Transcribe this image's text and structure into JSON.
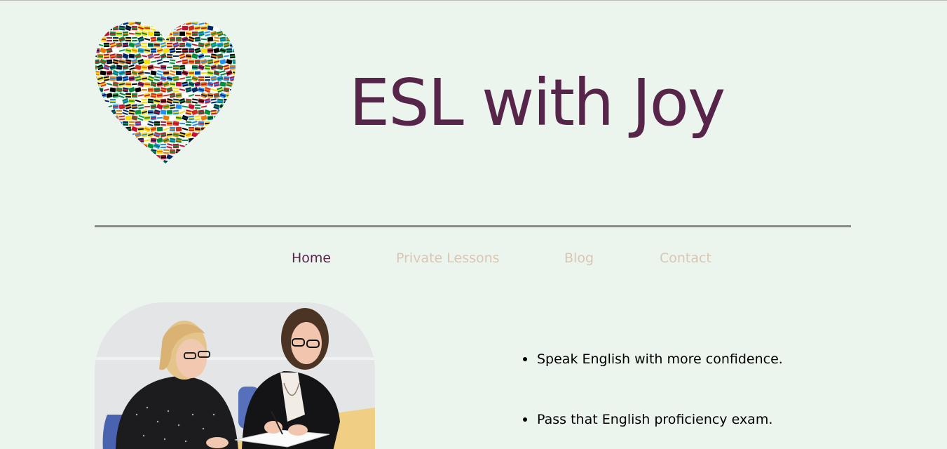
{
  "site": {
    "title": "ESL with Joy"
  },
  "nav": {
    "items": [
      {
        "label": "Home",
        "active": true
      },
      {
        "label": "Private Lessons",
        "active": false
      },
      {
        "label": "Blog",
        "active": false
      },
      {
        "label": "Contact",
        "active": false
      }
    ]
  },
  "hero": {
    "benefits": [
      "Speak English with more confidence.",
      "Pass that English proficiency exam."
    ]
  },
  "colors": {
    "background": "#ebf5ee",
    "title": "#57244a",
    "nav_active": "#57244a",
    "nav_inactive": "#d9c6b4",
    "divider": "#8a8a8a"
  },
  "icons": {
    "logo": "flag-heart-logo",
    "photo": "tutoring-photo"
  }
}
